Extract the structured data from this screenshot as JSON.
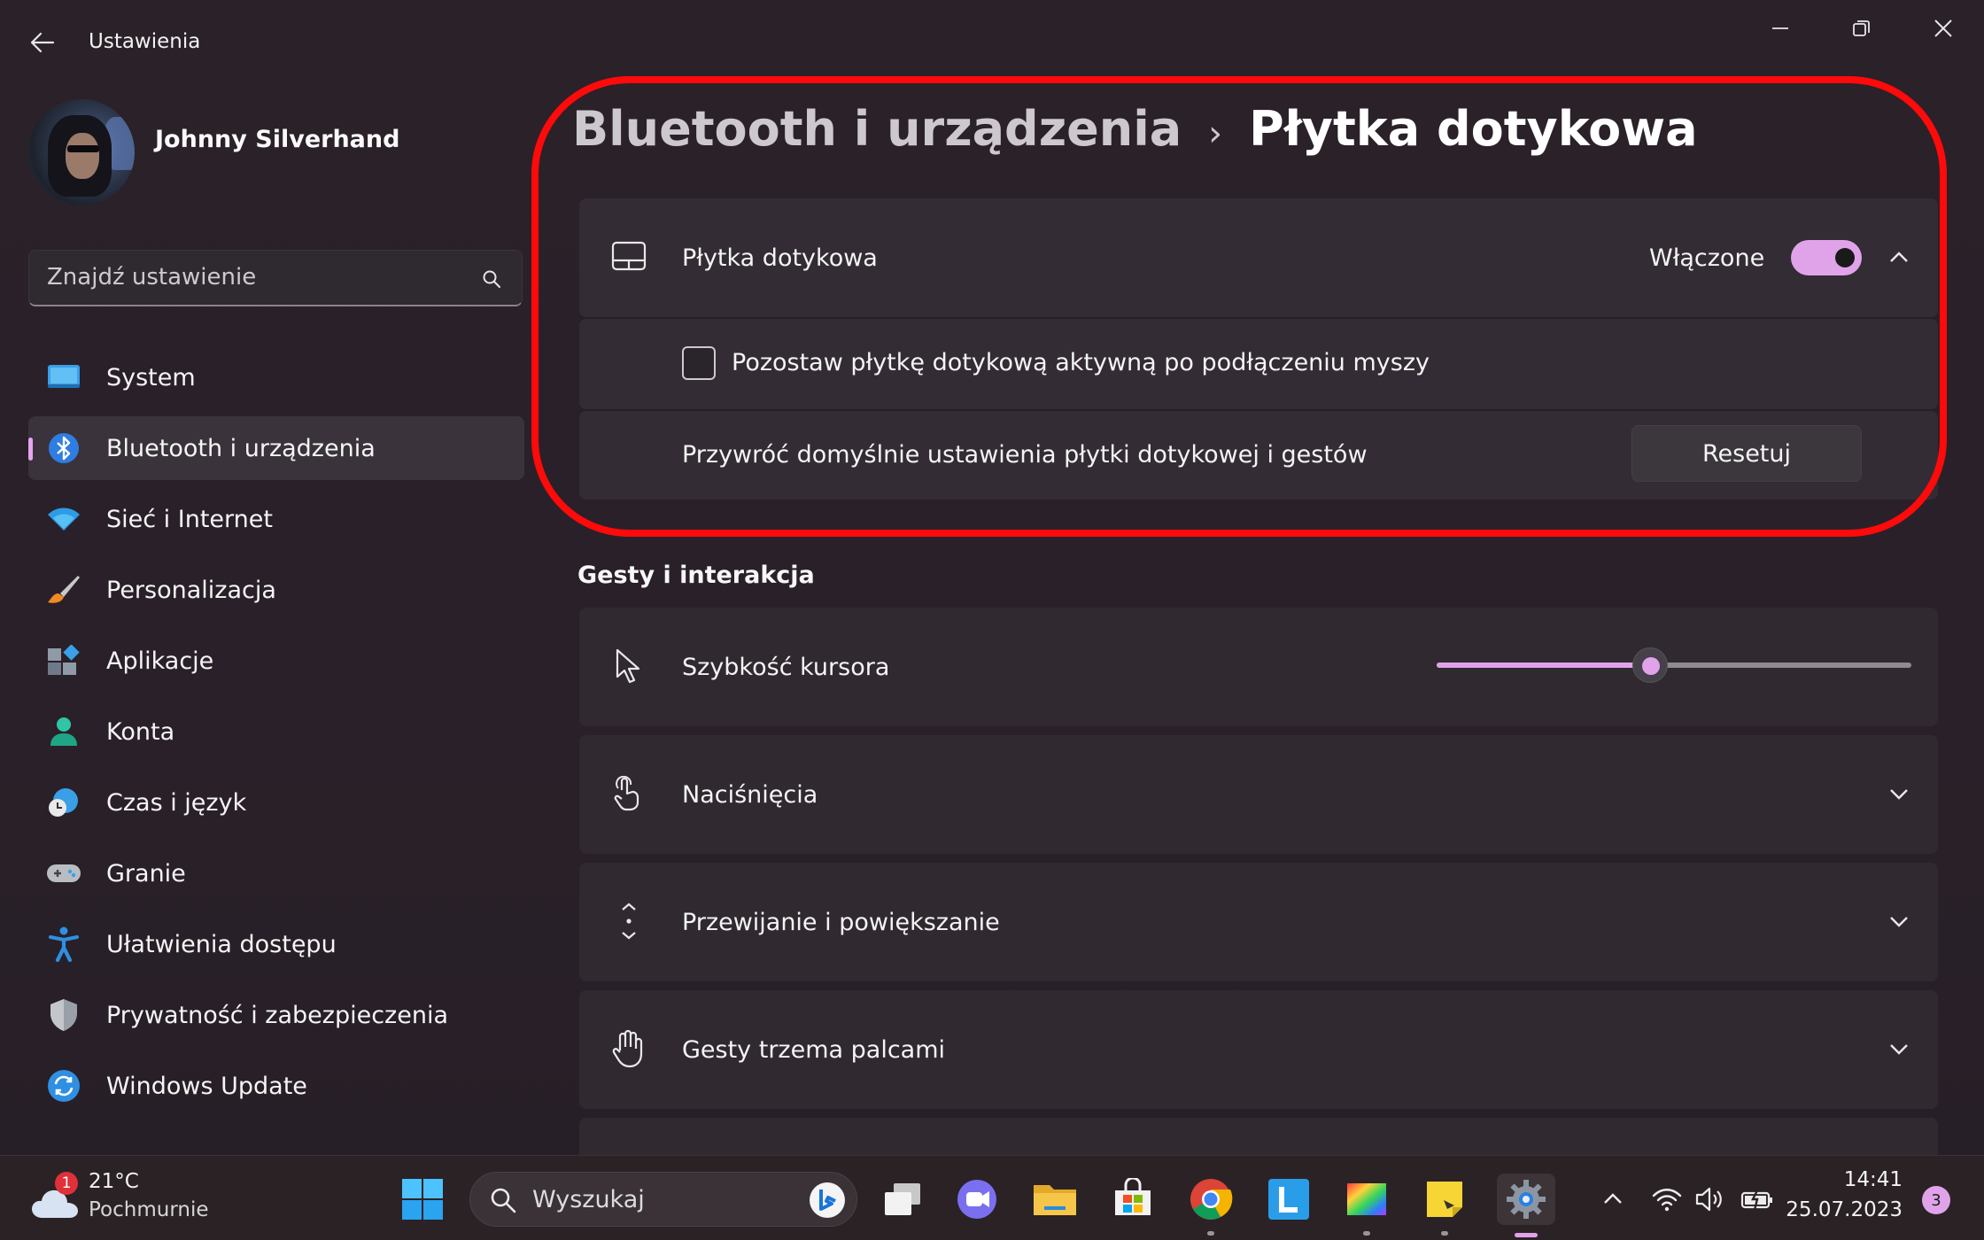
{
  "window": {
    "title": "Ustawienia"
  },
  "profile": {
    "name": "Johnny Silverhand"
  },
  "search": {
    "placeholder": "Znajdź ustawienie"
  },
  "sidebar": {
    "items": [
      {
        "label": "System",
        "icon": "display-icon"
      },
      {
        "label": "Bluetooth i urządzenia",
        "icon": "bluetooth-icon",
        "active": true
      },
      {
        "label": "Sieć i Internet",
        "icon": "wifi-icon"
      },
      {
        "label": "Personalizacja",
        "icon": "brush-icon"
      },
      {
        "label": "Aplikacje",
        "icon": "apps-icon"
      },
      {
        "label": "Konta",
        "icon": "person-icon"
      },
      {
        "label": "Czas i język",
        "icon": "clock-globe-icon"
      },
      {
        "label": "Granie",
        "icon": "gamepad-icon"
      },
      {
        "label": "Ułatwienia dostępu",
        "icon": "accessibility-icon"
      },
      {
        "label": "Prywatność i zabezpieczenia",
        "icon": "shield-icon"
      },
      {
        "label": "Windows Update",
        "icon": "update-icon"
      }
    ]
  },
  "breadcrumb": {
    "parent": "Bluetooth i urządzenia",
    "separator": "›",
    "current": "Płytka dotykowa"
  },
  "touchpad": {
    "label": "Płytka dotykowa",
    "state_label": "Włączone",
    "enabled": true,
    "keep_active_label": "Pozostaw płytkę dotykową aktywną po podłączeniu myszy",
    "keep_active_checked": false,
    "reset_label": "Przywróć domyślnie ustawienia płytki dotykowej i gestów",
    "reset_button": "Resetuj"
  },
  "gestures": {
    "section_title": "Gesty i interakcja",
    "cursor_speed_label": "Szybkość kursora",
    "cursor_speed_fraction": 0.45,
    "rows": [
      {
        "label": "Naciśnięcia",
        "icon": "tap-icon"
      },
      {
        "label": "Przewijanie i powiększanie",
        "icon": "scroll-icon"
      },
      {
        "label": "Gesty trzema palcami",
        "icon": "hand-icon"
      }
    ]
  },
  "taskbar": {
    "weather_temp": "21°C",
    "weather_desc": "Pochmurnie",
    "weather_badge": "1",
    "search_placeholder": "Wyszukaj",
    "time": "14:41",
    "date": "25.07.2023",
    "notifications": "3"
  },
  "colors": {
    "accent": "#e0a3ea",
    "highlight": "#ff0a0a",
    "background": "#272028"
  }
}
